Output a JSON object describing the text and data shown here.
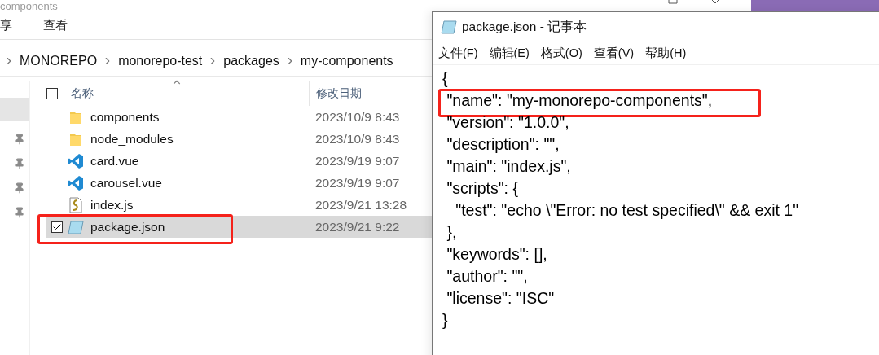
{
  "explorer": {
    "title": "components",
    "ribbon_tabs": [
      {
        "label": "享"
      },
      {
        "label": "查看"
      }
    ],
    "breadcrumb": [
      "MONOREPO",
      "monorepo-test",
      "packages",
      "my-components"
    ],
    "columns": [
      "名称",
      "修改日期"
    ],
    "select_all": {
      "checked": false
    },
    "files": [
      {
        "name": "components",
        "kind": "folder",
        "modified": "2023/10/9 8:43",
        "selected": false,
        "highlighted": false
      },
      {
        "name": "node_modules",
        "kind": "folder",
        "modified": "2023/10/9 8:43",
        "selected": false,
        "highlighted": false
      },
      {
        "name": "card.vue",
        "kind": "vscode",
        "modified": "2023/9/19 9:07",
        "selected": false,
        "highlighted": false
      },
      {
        "name": "carousel.vue",
        "kind": "vscode",
        "modified": "2023/9/19 9:07",
        "selected": false,
        "highlighted": false
      },
      {
        "name": "index.js",
        "kind": "script",
        "modified": "2023/9/21 13:28",
        "selected": false,
        "highlighted": false
      },
      {
        "name": "package.json",
        "kind": "notepad",
        "modified": "2023/9/21 9:22",
        "selected": true,
        "highlighted": true
      }
    ]
  },
  "notepad": {
    "title": "package.json - 记事本",
    "menu": [
      "文件(F)",
      "编辑(E)",
      "格式(O)",
      "查看(V)",
      "帮助(H)"
    ],
    "lines": [
      {
        "text": "{",
        "highlighted": false
      },
      {
        "text": " \"name\": \"my-monorepo-components\",",
        "highlighted": true
      },
      {
        "text": " \"version\": \"1.0.0\",",
        "highlighted": false
      },
      {
        "text": " \"description\": \"\",",
        "highlighted": false
      },
      {
        "text": " \"main\": \"index.js\",",
        "highlighted": false
      },
      {
        "text": " \"scripts\": {",
        "highlighted": false
      },
      {
        "text": "   \"test\": \"echo \\\"Error: no test specified\\\" && exit 1\"",
        "highlighted": false
      },
      {
        "text": " },",
        "highlighted": false
      },
      {
        "text": " \"keywords\": [],",
        "highlighted": false
      },
      {
        "text": " \"author\": \"\",",
        "highlighted": false
      },
      {
        "text": " \"license\": \"ISC\"",
        "highlighted": false
      },
      {
        "text": "}",
        "highlighted": false
      }
    ]
  }
}
